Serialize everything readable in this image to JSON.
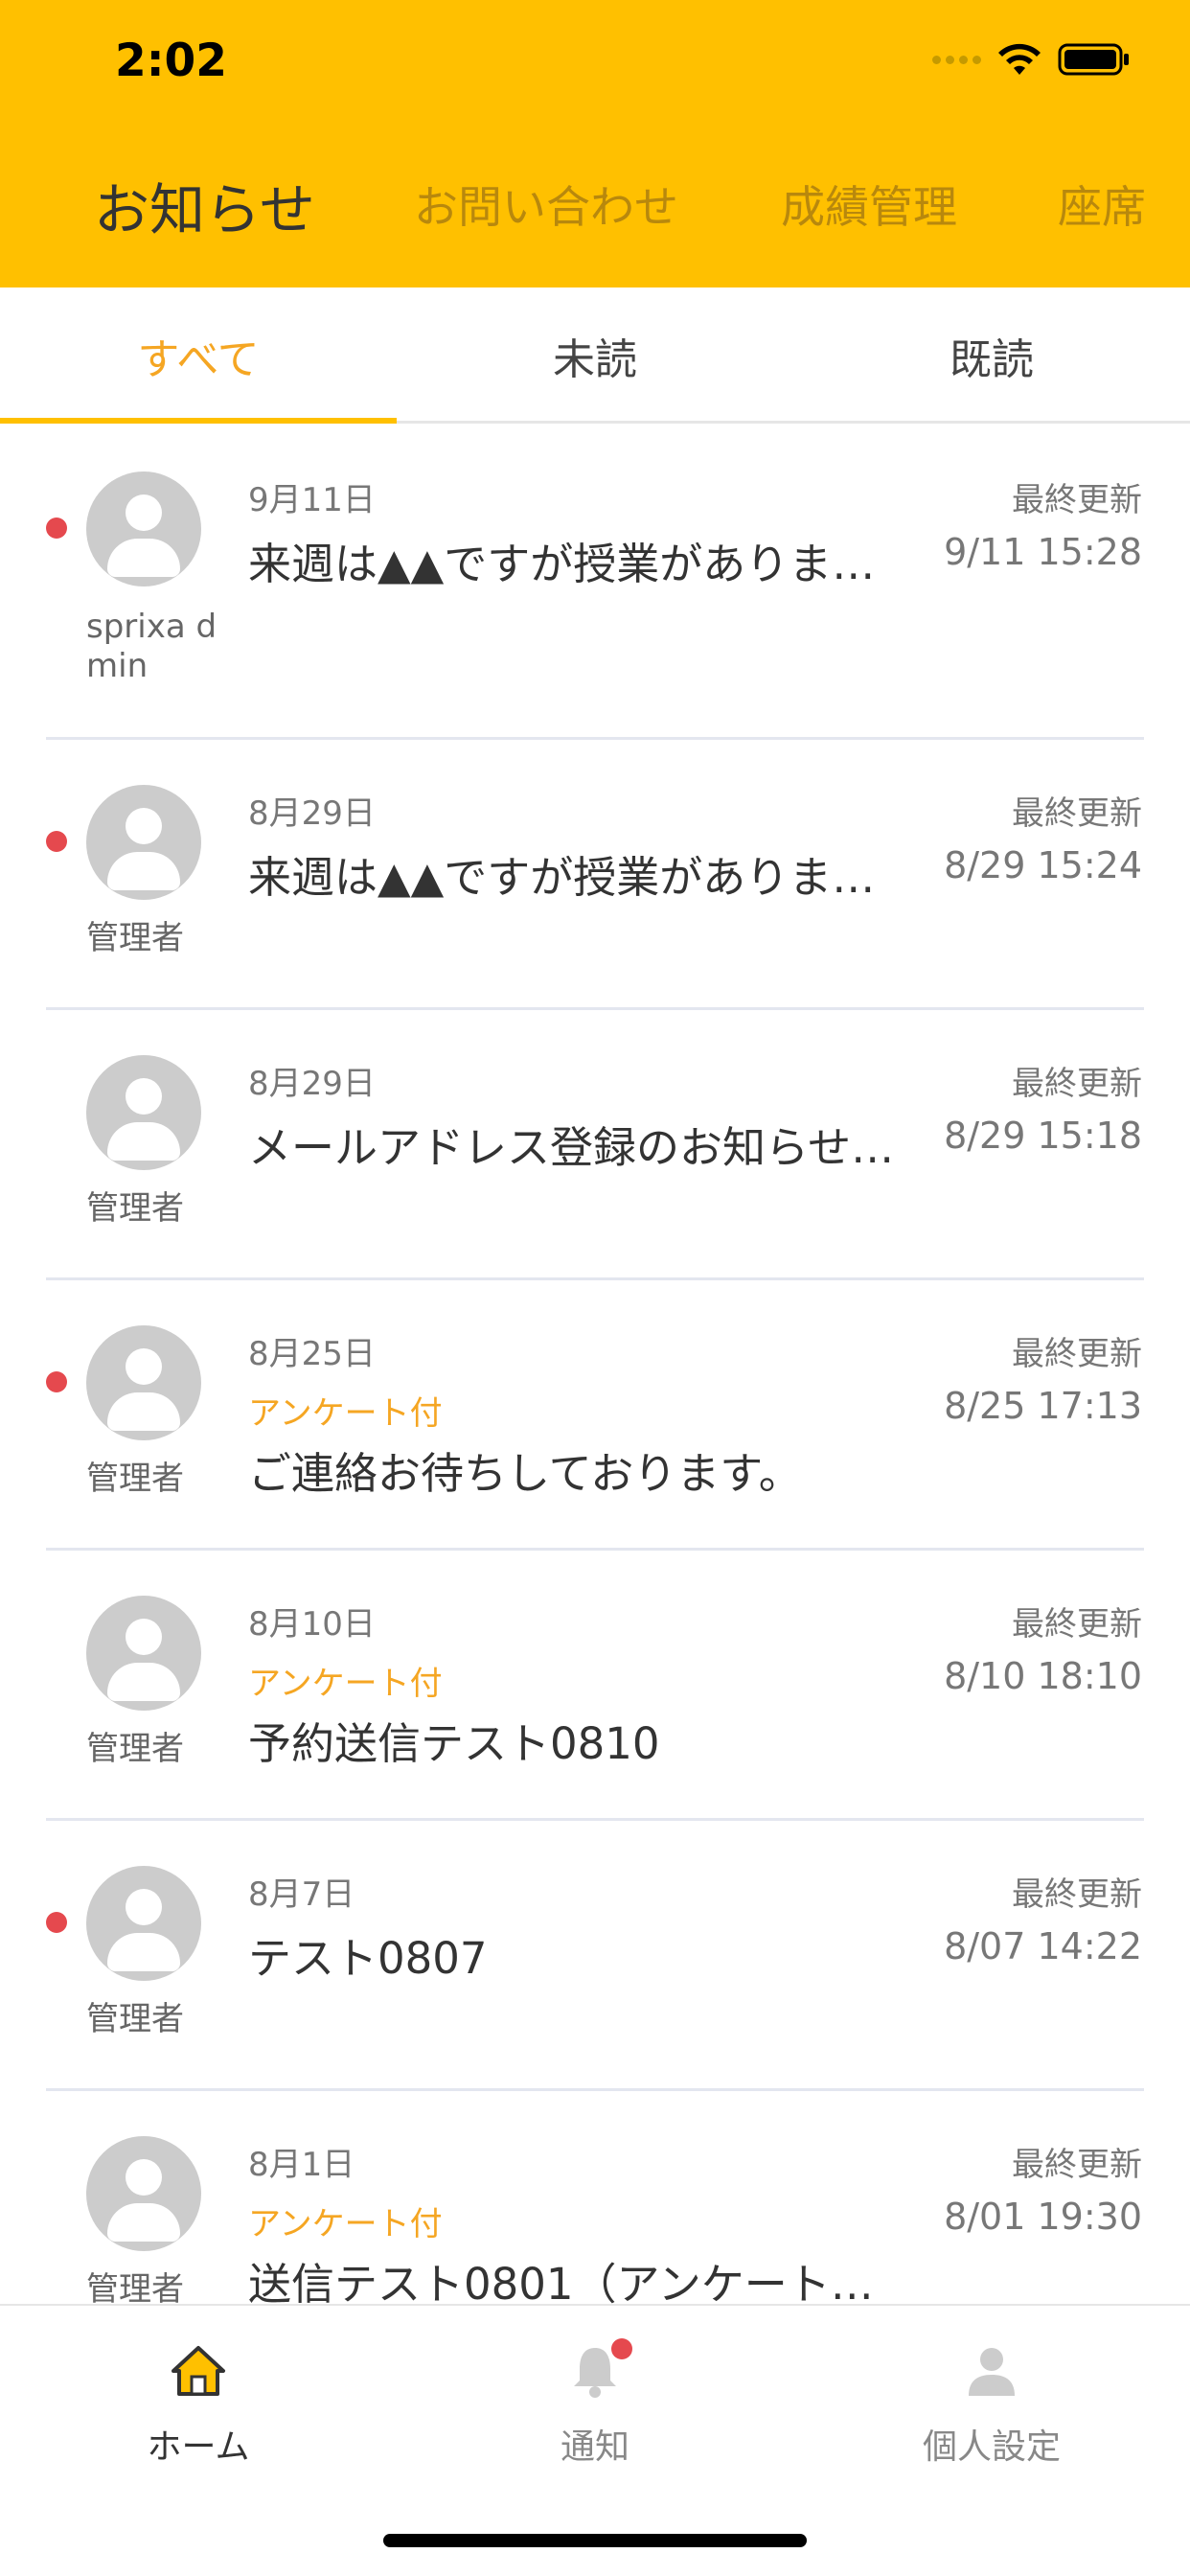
{
  "status_bar": {
    "time": "2:02"
  },
  "colors": {
    "accent": "#FFC000",
    "active_text": "#F5A623",
    "unread": "#E5494E"
  },
  "top_tabs": [
    "お知らせ",
    "お問い合わせ",
    "成績管理",
    "座席"
  ],
  "segments": [
    "すべて",
    "未読",
    "既読"
  ],
  "items": [
    {
      "date": "9月11日",
      "sender": "sprixa dmin",
      "survey": "",
      "title": "来週は▲▲ですが授業がありま…",
      "updated_label": "最終更新",
      "updated_time": "9/11 15:28",
      "unread": true
    },
    {
      "date": "8月29日",
      "sender": "管理者",
      "survey": "",
      "title": "来週は▲▲ですが授業がありま…",
      "updated_label": "最終更新",
      "updated_time": "8/29 15:24",
      "unread": true
    },
    {
      "date": "8月29日",
      "sender": "管理者",
      "survey": "",
      "title": "メールアドレス登録のお知らせ…",
      "updated_label": "最終更新",
      "updated_time": "8/29 15:18",
      "unread": false
    },
    {
      "date": "8月25日",
      "sender": "管理者",
      "survey": "アンケート付",
      "title": "ご連絡お待ちしております。",
      "updated_label": "最終更新",
      "updated_time": "8/25 17:13",
      "unread": true
    },
    {
      "date": "8月10日",
      "sender": "管理者",
      "survey": "アンケート付",
      "title": "予約送信テスト0810",
      "updated_label": "最終更新",
      "updated_time": "8/10 18:10",
      "unread": false
    },
    {
      "date": "8月7日",
      "sender": "管理者",
      "survey": "",
      "title": "テスト0807",
      "updated_label": "最終更新",
      "updated_time": "8/07 14:22",
      "unread": true
    },
    {
      "date": "8月1日",
      "sender": "管理者",
      "survey": "アンケート付",
      "title": "送信テスト0801（アンケート…",
      "updated_label": "最終更新",
      "updated_time": "8/01 19:30",
      "unread": false
    }
  ],
  "bottom_nav": {
    "home": {
      "label": "ホーム",
      "icon": "home-icon"
    },
    "notifications": {
      "label": "通知",
      "icon": "bell-icon"
    },
    "settings": {
      "label": "個人設定",
      "icon": "person-icon"
    }
  }
}
